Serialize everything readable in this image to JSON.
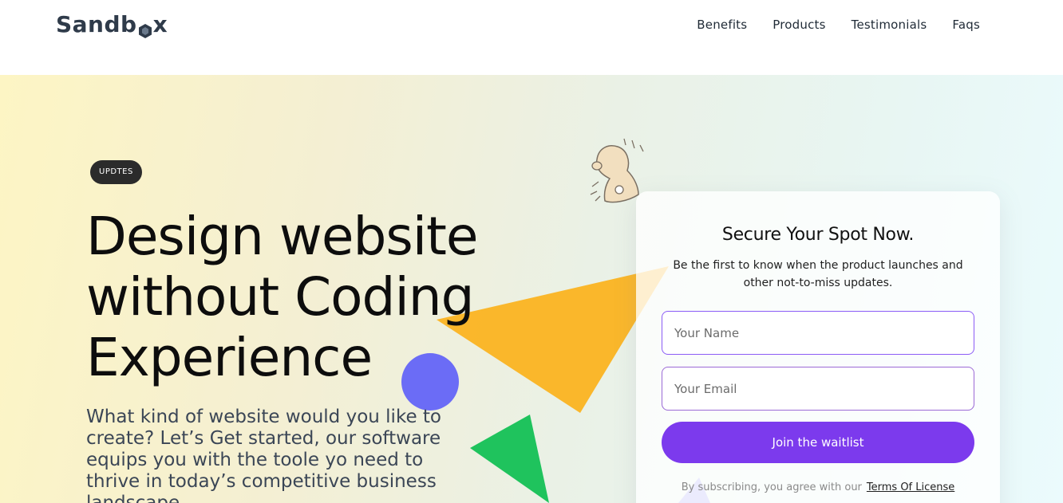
{
  "header": {
    "logo_text_before": "Sandb",
    "logo_text_after": "x",
    "nav": [
      {
        "label": "Benefits"
      },
      {
        "label": "Products"
      },
      {
        "label": "Testimonials"
      },
      {
        "label": "Faqs"
      }
    ]
  },
  "hero": {
    "badge": "UPDTES",
    "headline_line1": "Design website",
    "headline_line2": "without Coding",
    "headline_line3": "Experience",
    "subtext": "What kind of website would you like to create? Let’s Get started, our software equips you with the toole yo need to thrive in today’s competitive business landscape."
  },
  "signup": {
    "title": "Secure Your Spot Now.",
    "description": "Be the first to know when the product launches and other not-to-miss updates.",
    "name_placeholder": "Your Name",
    "email_placeholder": "Your Email",
    "button_label": "Join the waitlist",
    "terms_text": "By subscribing, you agree with our",
    "terms_link": "Terms Of License"
  },
  "colors": {
    "accent": "#7c3aed",
    "triangle_orange": "#fbb321",
    "circle_blue": "#6b6cf6",
    "triangle_green": "#1fc35d"
  },
  "icons": [
    "bell-icon",
    "logo-hexagon-icon"
  ]
}
